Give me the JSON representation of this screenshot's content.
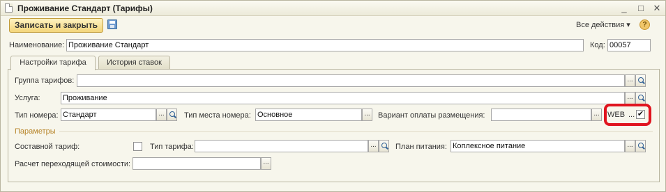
{
  "window": {
    "title": "Проживание Стандарт (Тарифы)"
  },
  "toolbar": {
    "save_close_label": "Записать и закрыть",
    "all_actions_label": "Все действия ▾",
    "help_label": "?"
  },
  "header": {
    "name_label": "Наименование:",
    "name_value": "Проживание Стандарт",
    "code_label": "Код:",
    "code_value": "00057"
  },
  "tabs": [
    {
      "label": "Настройки тарифа"
    },
    {
      "label": "История ставок"
    }
  ],
  "form": {
    "tariff_group_label": "Группа тарифов:",
    "tariff_group_value": "",
    "service_label": "Услуга:",
    "service_value": "Проживание",
    "room_type_label": "Тип номера:",
    "room_type_value": "Стандарт",
    "room_place_label": "Тип места номера:",
    "room_place_value": "Основное",
    "payment_label": "Вариант оплаты размещения:",
    "payment_value": "",
    "web_label": "WEB",
    "web_checked": "✔",
    "params_label": "Параметры",
    "composite_label": "Составной тариф:",
    "tariff_type_label": "Тип тарифа:",
    "tariff_type_value": "",
    "meal_plan_label": "План питания:",
    "meal_plan_value": "Коплексное питание",
    "carryover_label": "Расчет переходящей стоимости:",
    "carryover_value": ""
  },
  "icons": {
    "ellipsis": "...",
    "close": "✕",
    "minimize": "_",
    "maximize": "□"
  }
}
